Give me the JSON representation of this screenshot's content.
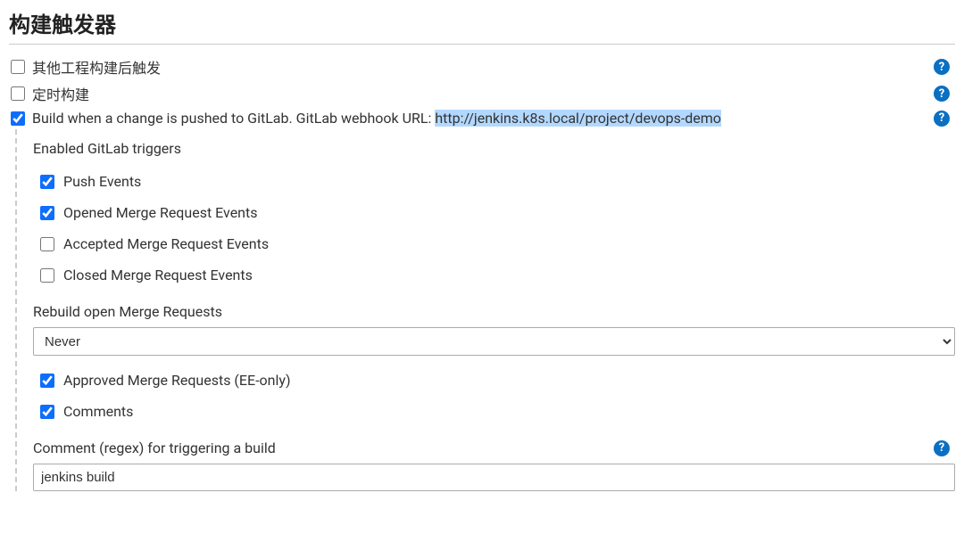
{
  "section_title": "构建触发器",
  "triggers": {
    "other_project": {
      "label": "其他工程构建后触发",
      "checked": false,
      "help": true
    },
    "periodic": {
      "label": "定时构建",
      "checked": false,
      "help": true
    },
    "gitlab": {
      "label_prefix": "Build when a change is pushed to GitLab. GitLab webhook URL: ",
      "url": "http://jenkins.k8s.local/project/devops-demo",
      "checked": true,
      "help": true
    }
  },
  "gitlab_triggers": {
    "title": "Enabled GitLab triggers",
    "push": {
      "label": "Push Events",
      "checked": true
    },
    "opened_mr": {
      "label": "Opened Merge Request Events",
      "checked": true
    },
    "accepted_mr": {
      "label": "Accepted Merge Request Events",
      "checked": false
    },
    "closed_mr": {
      "label": "Closed Merge Request Events",
      "checked": false
    },
    "rebuild_label": "Rebuild open Merge Requests",
    "rebuild_value": "Never",
    "approved_mr": {
      "label": "Approved Merge Requests (EE-only)",
      "checked": true
    },
    "comments": {
      "label": "Comments",
      "checked": true
    },
    "comment_regex_label": "Comment (regex) for triggering a build",
    "comment_regex_value": "jenkins build"
  }
}
